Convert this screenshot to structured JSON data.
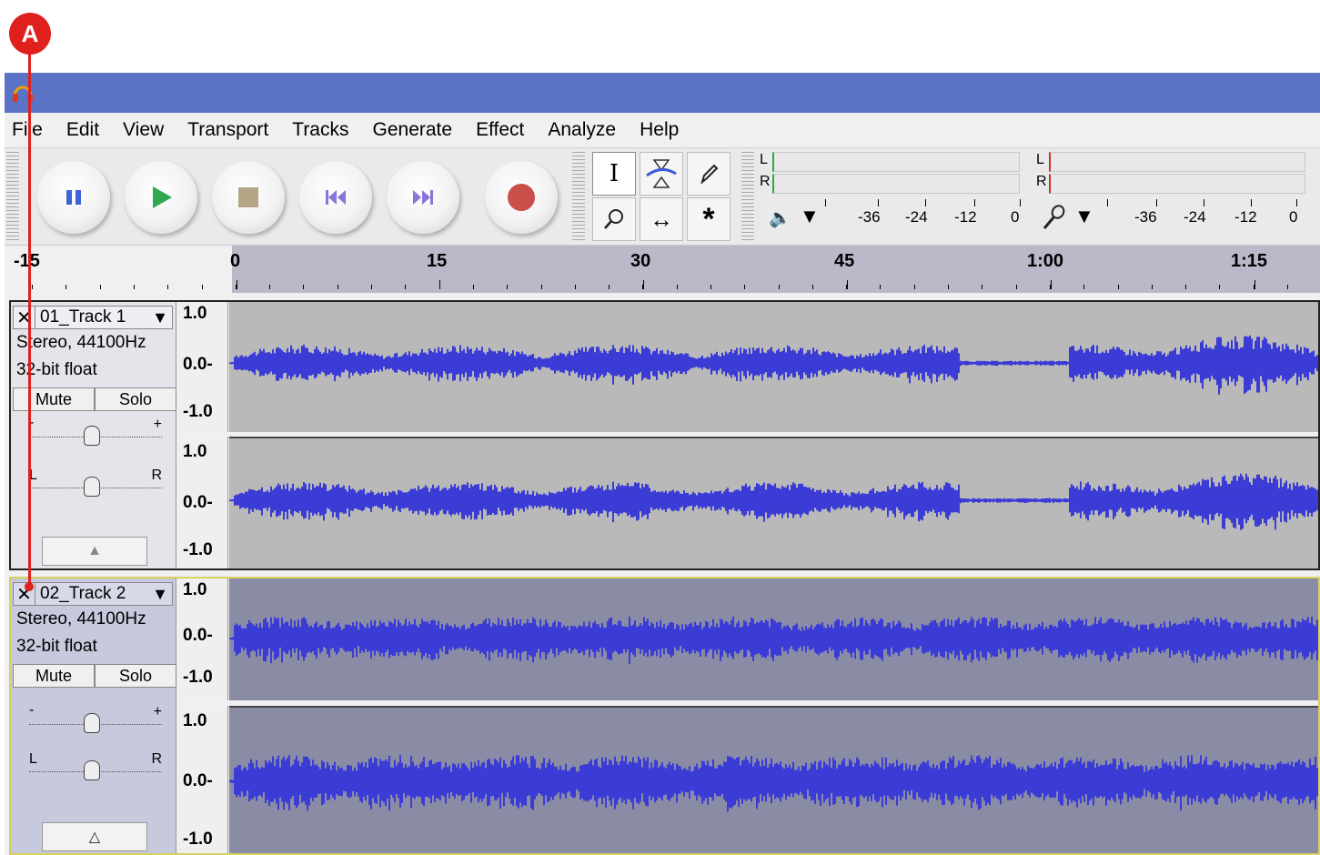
{
  "callout": {
    "label": "A"
  },
  "menu": [
    "File",
    "Edit",
    "View",
    "Transport",
    "Tracks",
    "Generate",
    "Effect",
    "Analyze",
    "Help"
  ],
  "meter": {
    "left_channel": "L",
    "right_channel": "R",
    "scale": [
      "-36",
      "-24",
      "-12",
      "0"
    ]
  },
  "ruler": {
    "labels": [
      "-15",
      "0",
      "15",
      "30",
      "45",
      "1:00",
      "1:15"
    ]
  },
  "tracks": [
    {
      "name": "01_Track 1",
      "info1": "Stereo, 44100Hz",
      "info2": "32-bit float",
      "mute": "Mute",
      "solo": "Solo",
      "gain_minus": "-",
      "gain_plus": "+",
      "pan_left": "L",
      "pan_right": "R",
      "scale": [
        "1.0",
        "0.0-",
        "-1.0"
      ],
      "selected": false
    },
    {
      "name": "02_Track 2",
      "info1": "Stereo, 44100Hz",
      "info2": "32-bit float",
      "mute": "Mute",
      "solo": "Solo",
      "gain_minus": "-",
      "gain_plus": "+",
      "pan_left": "L",
      "pan_right": "R",
      "scale": [
        "1.0",
        "0.0-",
        "-1.0"
      ],
      "selected": true
    }
  ],
  "colors": {
    "title_bar": "#5b73c6",
    "waveform": "#3b3bd6",
    "callout": "#e0201c",
    "selected_track_bg": "#8a8ca6"
  }
}
